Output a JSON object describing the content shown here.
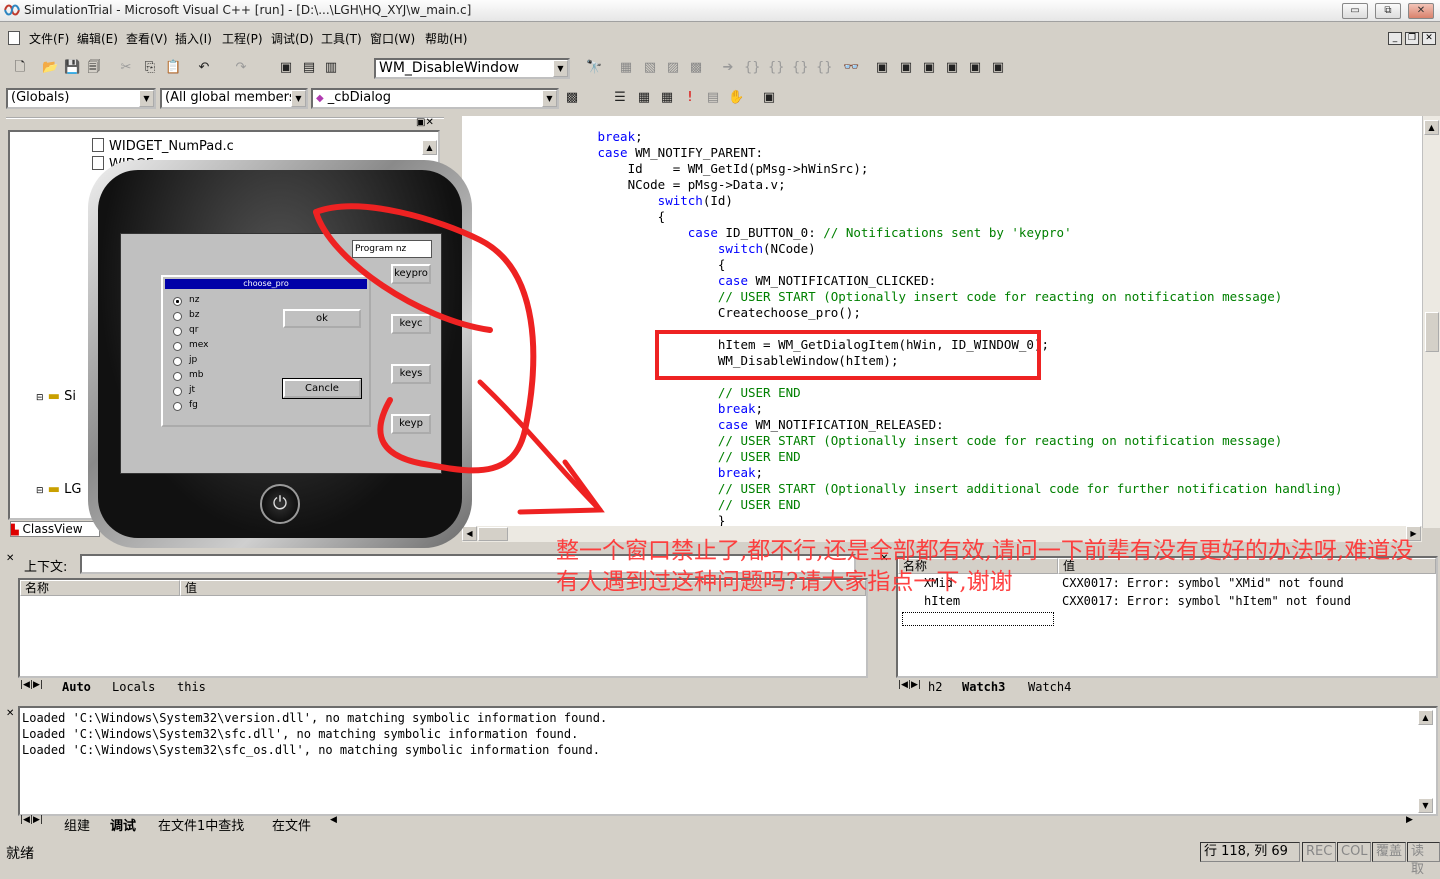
{
  "window": {
    "title": "SimulationTrial - Microsoft Visual C++ [run] - [D:\\...\\LGH\\HQ_XYJ\\w_main.c]",
    "min": "▭",
    "restore": "⧉",
    "close": "✕"
  },
  "menu": {
    "items": [
      "文件(F)",
      "编辑(E)",
      "查看(V)",
      "插入(I)",
      "工程(P)",
      "调试(D)",
      "工具(T)",
      "窗口(W)",
      "帮助(H)"
    ]
  },
  "toolbar": {
    "find_combo": "WM_DisableWindow",
    "scope_combo": "(Globals)",
    "members_combo": "(All global members",
    "func_combo": "_cbDialog"
  },
  "tree": {
    "items": [
      "WIDGET_NumPad.c",
      "WIDGE",
      "Si",
      "LG"
    ],
    "tab": "ClassView"
  },
  "code": {
    "lines": [
      {
        "i": "        ",
        "t": "break;",
        "c": "kw"
      },
      {
        "i": "        ",
        "t": "case WM_NOTIFY_PARENT:",
        "c": "mix",
        "k": "case"
      },
      {
        "i": "            ",
        "t": "Id    = WM_GetId(pMsg->hWinSrc);",
        "c": ""
      },
      {
        "i": "            ",
        "t": "NCode = pMsg->Data.v;",
        "c": ""
      },
      {
        "i": "                ",
        "t": "switch(Id)",
        "c": "kw"
      },
      {
        "i": "                ",
        "t": "{",
        "c": ""
      },
      {
        "i": "                    ",
        "t": "case ID_BUTTON_0: ",
        "c": "mix",
        "k": "case",
        "cm": "// Notifications sent by 'keypro'"
      },
      {
        "i": "                        ",
        "t": "switch(NCode)",
        "c": "kw"
      },
      {
        "i": "                        ",
        "t": "{",
        "c": ""
      },
      {
        "i": "                        ",
        "t": "case WM_NOTIFICATION_CLICKED:",
        "c": "mix",
        "k": "case"
      },
      {
        "i": "                        ",
        "t": "// USER START (Optionally insert code for reacting on notification message)",
        "c": "cm"
      },
      {
        "i": "                        ",
        "t": "Createchoose_pro();",
        "c": ""
      },
      {
        "i": "",
        "t": "",
        "c": ""
      },
      {
        "i": "                        ",
        "t": "hItem = WM_GetDialogItem(hWin, ID_WINDOW_0);",
        "c": ""
      },
      {
        "i": "                        ",
        "t": "WM_DisableWindow(hItem);",
        "c": ""
      },
      {
        "i": "",
        "t": "",
        "c": ""
      },
      {
        "i": "                        ",
        "t": "// USER END",
        "c": "cm"
      },
      {
        "i": "                        ",
        "t": "break;",
        "c": "kw"
      },
      {
        "i": "                        ",
        "t": "case WM_NOTIFICATION_RELEASED:",
        "c": "mix",
        "k": "case"
      },
      {
        "i": "                        ",
        "t": "// USER START (Optionally insert code for reacting on notification message)",
        "c": "cm"
      },
      {
        "i": "                        ",
        "t": "// USER END",
        "c": "cm"
      },
      {
        "i": "                        ",
        "t": "break;",
        "c": "kw"
      },
      {
        "i": "                        ",
        "t": "// USER START (Optionally insert additional code for further notification handling)",
        "c": "cm"
      },
      {
        "i": "                        ",
        "t": "// USER END",
        "c": "cm"
      },
      {
        "i": "                        ",
        "t": "}",
        "c": ""
      }
    ]
  },
  "device": {
    "program_label": "Program nz",
    "side_buttons": [
      "keypro",
      "keyc",
      "keys",
      "keyp"
    ],
    "dialog_title": "choose_pro",
    "options": [
      "nz",
      "bz",
      "qr",
      "mex",
      "jp",
      "mb",
      "jt",
      "fg"
    ],
    "selected": "nz",
    "ok": "ok",
    "cancel": "Cancle",
    "power": "⏻"
  },
  "variables": {
    "context_label": "上下文:",
    "col_name": "名称",
    "col_value": "值",
    "tabs": [
      "Auto",
      "Locals",
      "this"
    ]
  },
  "watch": {
    "col_name": "名称",
    "col_value": "值",
    "rows": [
      {
        "name": "XMid",
        "value": "CXX0017: Error: symbol \"XMid\" not found"
      },
      {
        "name": "hItem",
        "value": "CXX0017: Error: symbol \"hItem\" not found"
      }
    ],
    "tabs": [
      "h2",
      "Watch3",
      "Watch4"
    ]
  },
  "output": {
    "lines": [
      "Loaded 'C:\\Windows\\System32\\version.dll', no matching symbolic information found.",
      "Loaded 'C:\\Windows\\System32\\sfc.dll', no matching symbolic information found.",
      "Loaded 'C:\\Windows\\System32\\sfc_os.dll', no matching symbolic information found."
    ],
    "tabs": [
      "组建",
      "调试",
      "在文件1中查找",
      "在文件"
    ]
  },
  "status": {
    "ready": "就绪",
    "pos": "行 118, 列 69",
    "rec": "REC",
    "col": "COL",
    "ovr": "覆盖",
    "read": "读取"
  },
  "annotation": {
    "text": "整一个窗口禁止了,都不行,还是全部都有效,请问一下前辈有没有更好的办法呀,难道没有人遇到过这种问题吗?请大家指点一下,谢谢",
    "color": "#ff3333"
  }
}
